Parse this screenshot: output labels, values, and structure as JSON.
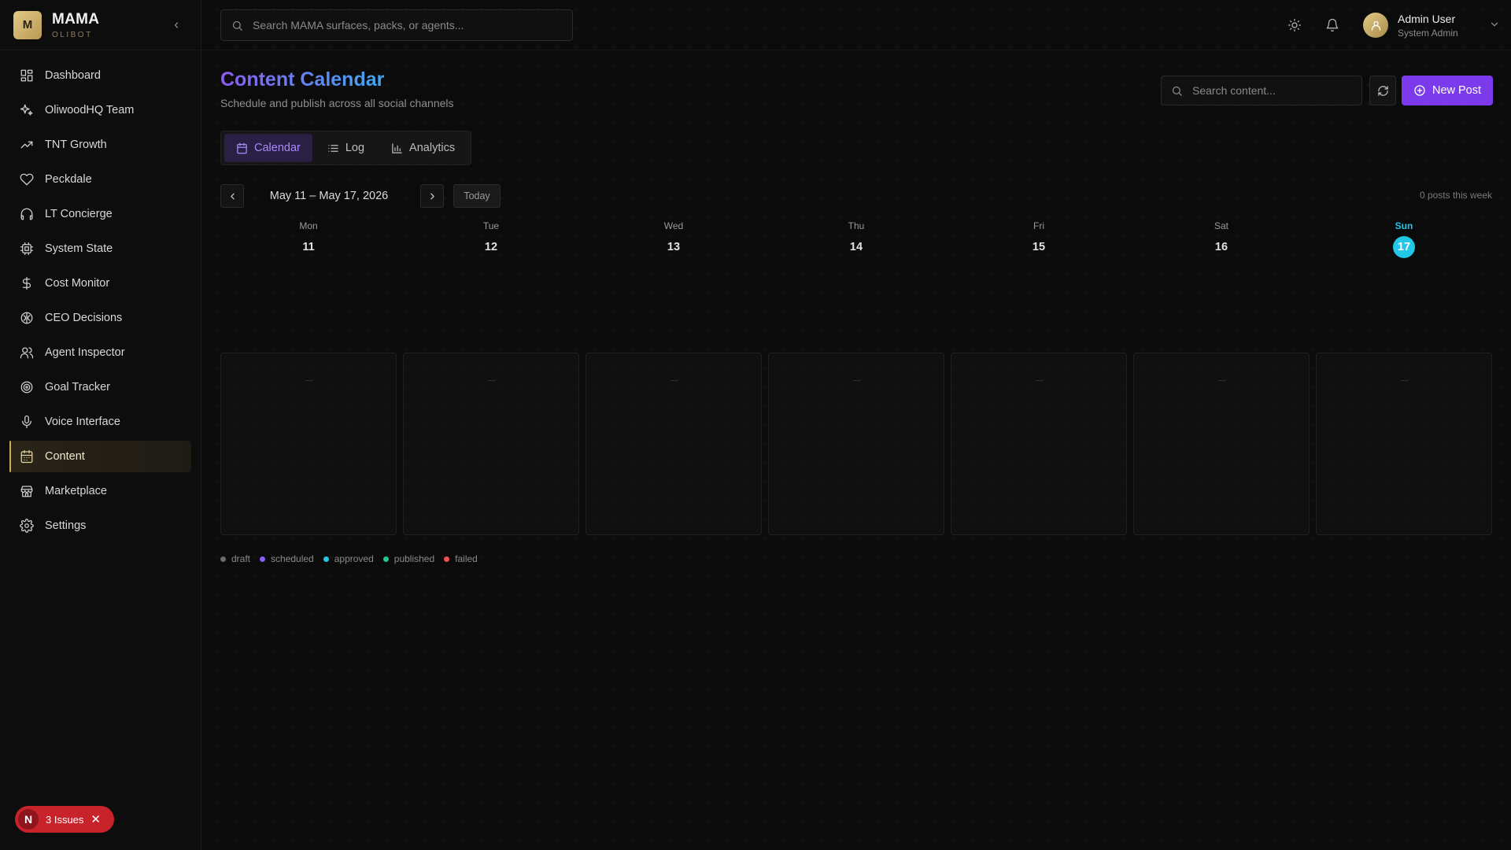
{
  "brand": {
    "name": "MAMA",
    "subtitle": "OLIBOT",
    "logo_letter": "M",
    "accent": "#c9a95c"
  },
  "sidebar": {
    "items": [
      {
        "label": "Dashboard",
        "icon": "grid-icon"
      },
      {
        "label": "OliwoodHQ Team",
        "icon": "sparkles-icon"
      },
      {
        "label": "TNT Growth",
        "icon": "trending-up-icon"
      },
      {
        "label": "Peckdale",
        "icon": "heart-icon"
      },
      {
        "label": "LT Concierge",
        "icon": "headphones-icon"
      },
      {
        "label": "System State",
        "icon": "cpu-icon"
      },
      {
        "label": "Cost Monitor",
        "icon": "dollar-icon"
      },
      {
        "label": "CEO Decisions",
        "icon": "brain-icon"
      },
      {
        "label": "Agent Inspector",
        "icon": "users-icon"
      },
      {
        "label": "Goal Tracker",
        "icon": "target-icon"
      },
      {
        "label": "Voice Interface",
        "icon": "mic-icon"
      },
      {
        "label": "Content",
        "icon": "calendar-icon",
        "active": true
      },
      {
        "label": "Marketplace",
        "icon": "store-icon"
      },
      {
        "label": "Settings",
        "icon": "gear-icon"
      }
    ],
    "issues": {
      "badge": "N",
      "label": "3 Issues",
      "color": "#c8222b"
    }
  },
  "topbar": {
    "search_placeholder": "Search MAMA surfaces, packs, or agents...",
    "user": {
      "name": "Admin User",
      "role": "System Admin"
    }
  },
  "page": {
    "title": "Content Calendar",
    "subtitle": "Schedule and publish across all social channels",
    "search_placeholder": "Search content...",
    "new_post_label": "New Post",
    "tabs": [
      {
        "label": "Calendar",
        "icon": "calendar-icon",
        "active": true
      },
      {
        "label": "Log",
        "icon": "list-icon"
      },
      {
        "label": "Analytics",
        "icon": "bar-chart-icon"
      }
    ],
    "week_label": "May 11 – May 17, 2026",
    "today_label": "Today",
    "posts_count": "0 posts this week",
    "days": [
      {
        "name": "Mon",
        "num": "11"
      },
      {
        "name": "Tue",
        "num": "12"
      },
      {
        "name": "Wed",
        "num": "13"
      },
      {
        "name": "Thu",
        "num": "14"
      },
      {
        "name": "Fri",
        "num": "15"
      },
      {
        "name": "Sat",
        "num": "16"
      },
      {
        "name": "Sun",
        "num": "17",
        "today": true
      }
    ],
    "legend": [
      {
        "label": "draft",
        "color": "#6b6b6b"
      },
      {
        "label": "scheduled",
        "color": "#8b5cf6"
      },
      {
        "label": "approved",
        "color": "#22c6e6"
      },
      {
        "label": "published",
        "color": "#22c58b"
      },
      {
        "label": "failed",
        "color": "#f05252"
      }
    ],
    "colors": {
      "primary": "#7c3aed",
      "today": "#22c6e6"
    }
  }
}
